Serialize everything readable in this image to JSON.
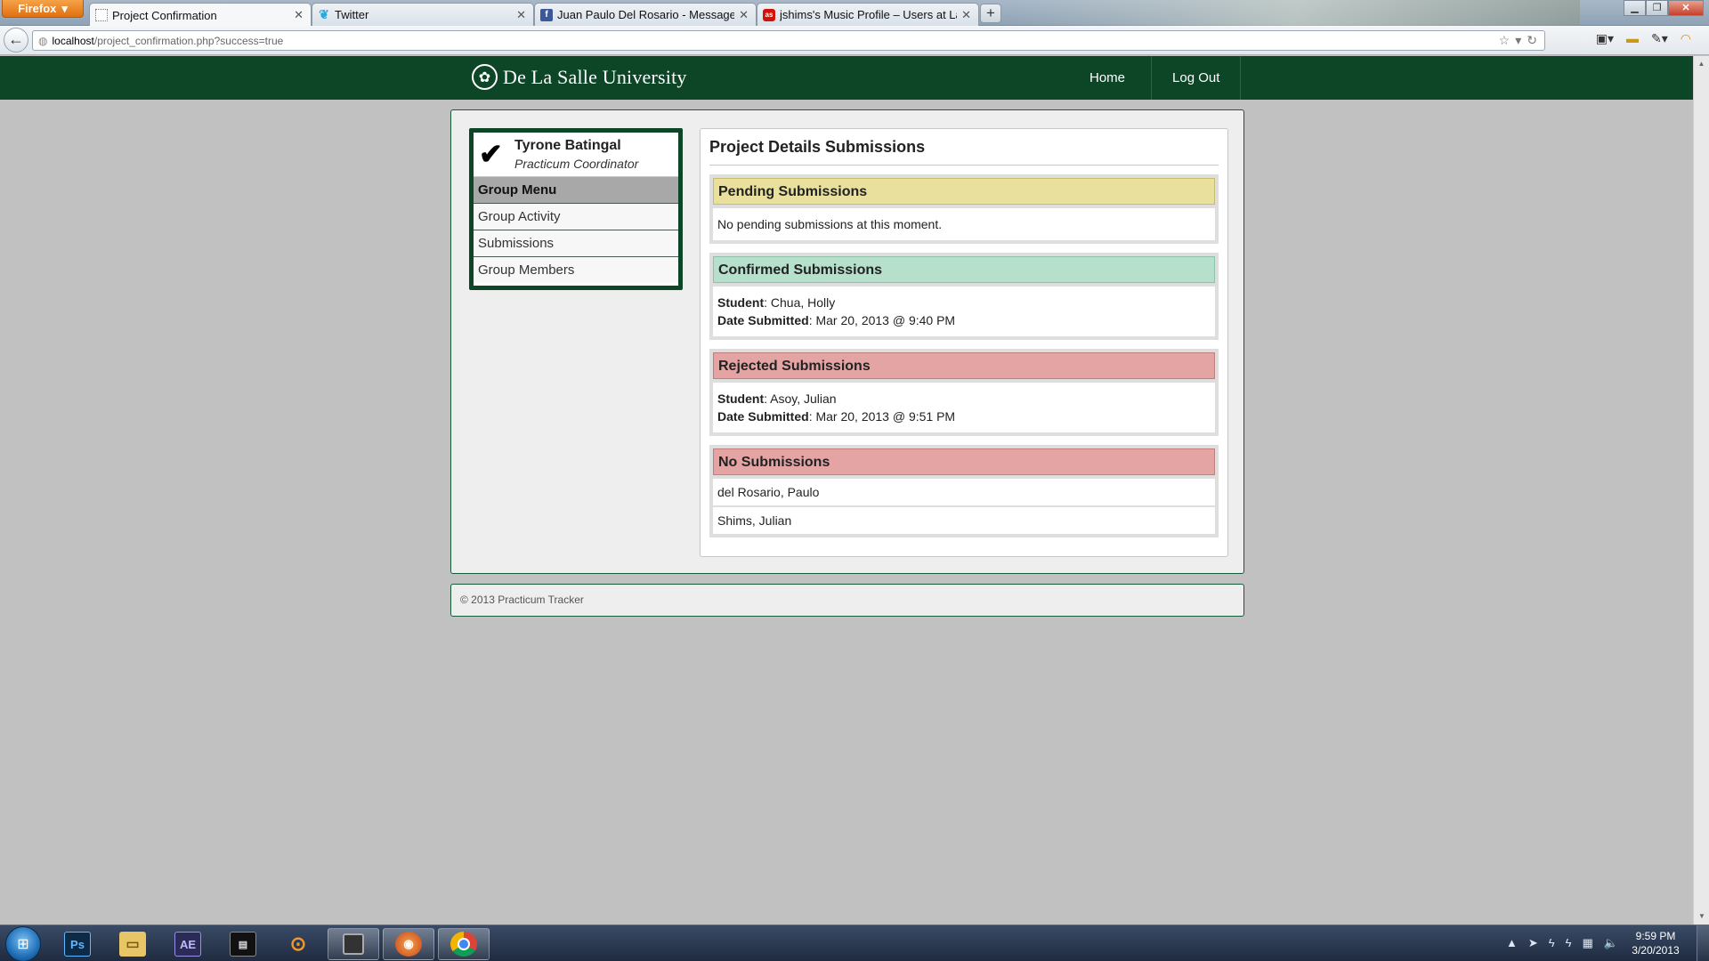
{
  "browser": {
    "app_button": "Firefox",
    "tabs": [
      {
        "label": "Project Confirmation",
        "favicon": "blank-page-icon"
      },
      {
        "label": "Twitter",
        "favicon": "twitter-icon"
      },
      {
        "label": "Juan Paulo Del Rosario - Messages",
        "favicon": "facebook-icon"
      },
      {
        "label": "jshims's Music Profile – Users at Last.f...",
        "favicon": "lastfm-icon"
      }
    ],
    "new_tab": "+",
    "url": {
      "host": "localhost",
      "path": "/project_confirmation.php?success=true"
    }
  },
  "site": {
    "brand": "De La Salle University",
    "nav": {
      "home": "Home",
      "logout": "Log Out"
    }
  },
  "user": {
    "name": "Tyrone Batingal",
    "role": "Practicum Coordinator"
  },
  "menu": {
    "heading": "Group Menu",
    "items": [
      "Group Activity",
      "Submissions",
      "Group Members"
    ]
  },
  "main": {
    "title": "Project Details Submissions",
    "pending": {
      "heading": "Pending Submissions",
      "message": "No pending submissions at this moment."
    },
    "confirmed": {
      "heading": "Confirmed Submissions",
      "student_label": "Student",
      "student": "Chua, Holly",
      "date_label": "Date Submitted",
      "date": "Mar 20, 2013 @ 9:40 PM"
    },
    "rejected": {
      "heading": "Rejected Submissions",
      "student_label": "Student",
      "student": "Asoy, Julian",
      "date_label": "Date Submitted",
      "date": "Mar 20, 2013 @ 9:51 PM"
    },
    "none": {
      "heading": "No Submissions",
      "students": [
        "del Rosario, Paulo",
        "Shims, Julian"
      ]
    }
  },
  "footer": {
    "text": "© 2013 Practicum Tracker"
  },
  "taskbar": {
    "apps": [
      "Ps",
      "AE"
    ],
    "clock": {
      "time": "9:59 PM",
      "date": "3/20/2013"
    }
  },
  "colors": {
    "header_green": "#0c4627",
    "pending": "#eae09e",
    "confirmed": "#b6e0cc",
    "rejected": "#e4a4a4"
  }
}
